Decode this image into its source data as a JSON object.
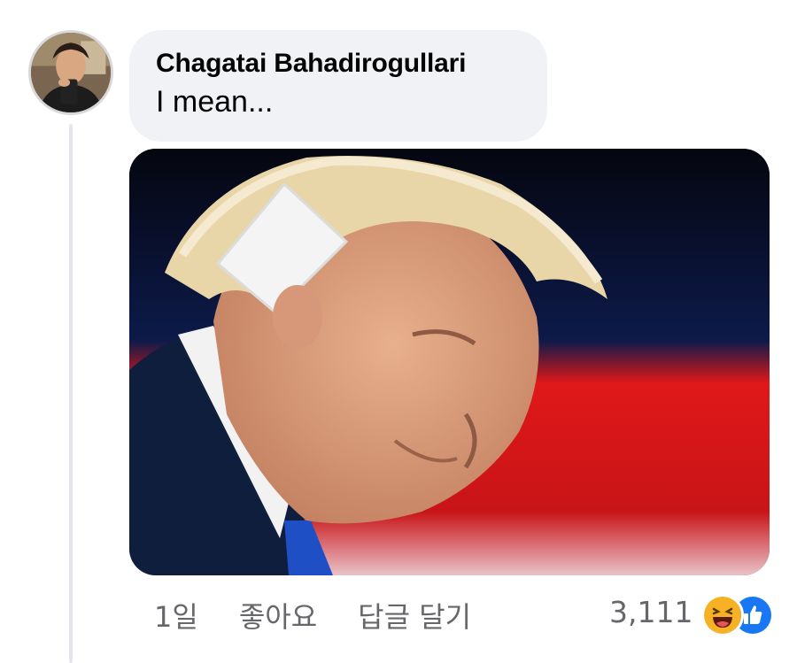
{
  "comment": {
    "author": "Chagatai Bahadirogullari",
    "text": "I mean...",
    "avatar_icon": "user-avatar",
    "attachment_icon": "photo-attachment"
  },
  "actions": {
    "time": "1일",
    "like_label": "좋아요",
    "reply_label": "답글 달기"
  },
  "reactions": {
    "count": "3,111",
    "types": [
      "haha-icon",
      "like-icon"
    ],
    "colors": {
      "haha": "#f7b125",
      "like": "#1877f2"
    }
  },
  "colors": {
    "bubble": "#f0f2f5",
    "meta_text": "#65676b",
    "thread_line": "#e4e6eb"
  }
}
